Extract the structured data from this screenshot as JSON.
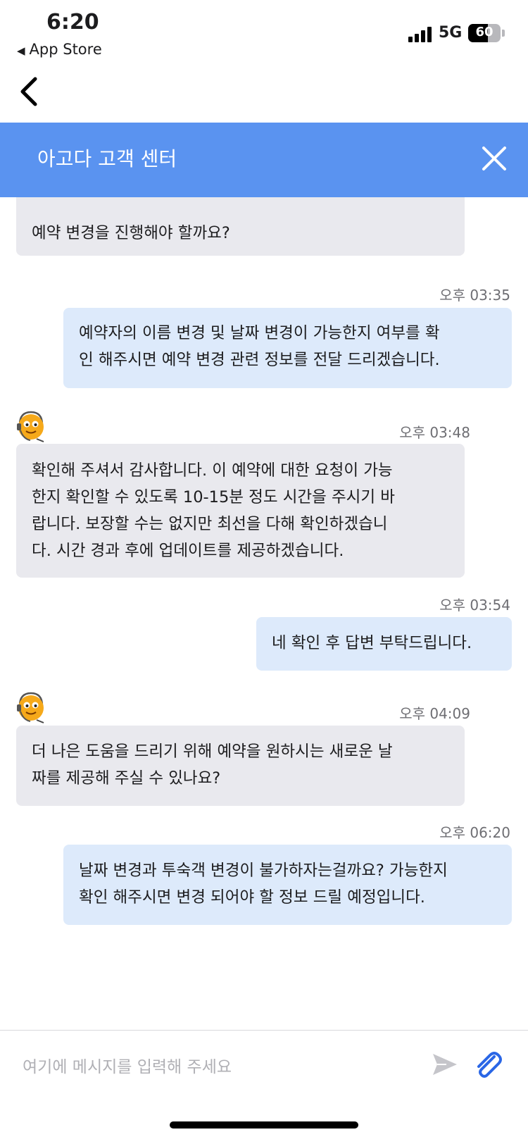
{
  "status_bar": {
    "time": "6:20",
    "back_app_label": "App Store",
    "network": "5G",
    "battery": "60",
    "battery_level": 0.6
  },
  "header": {
    "title": "아고다 고객 센터"
  },
  "messages": [
    {
      "sender": "agent",
      "text": "예약 변경을 진행해야 할까요?"
    },
    {
      "sender": "user",
      "time": "오후 03:35",
      "lines": [
        "예약자의 이름 변경 및 날짜 변경이 가능한지 여부를 확",
        "인 해주시면 예약 변경 관련 정보를 전달 드리겠습니다."
      ]
    },
    {
      "sender": "agent",
      "time": "오후 03:48",
      "lines": [
        "확인해 주셔서 감사합니다. 이 예약에 대한 요청이 가능",
        "한지 확인할 수 있도록 10-15분 정도 시간을 주시기 바",
        "랍니다. 보장할 수는 없지만 최선을 다해 확인하겠습니",
        "다. 시간 경과 후에 업데이트를 제공하겠습니다."
      ]
    },
    {
      "sender": "user",
      "time": "오후 03:54",
      "lines": [
        "네 확인 후 답변 부탁드립니다."
      ]
    },
    {
      "sender": "agent",
      "time": "오후 04:09",
      "lines": [
        "더 나은 도움을 드리기 위해 예약을 원하시는 새로운 날",
        "짜를 제공해 주실 수 있나요?"
      ]
    },
    {
      "sender": "user",
      "time": "오후 06:20",
      "lines": [
        "날짜 변경과 투숙객 변경이 불가하자는걸까요? 가능한지",
        "확인 해주시면 변경 되어야 할 정보 드릴 예정입니다."
      ]
    }
  ],
  "composer": {
    "placeholder": "여기에 메시지를 입력해 주세요"
  },
  "colors": {
    "header": "#5a93f0",
    "agent_bubble": "#e9e9ee",
    "user_bubble": "#ddeafb",
    "attach_icon": "#2a66e6"
  },
  "icons": [
    "chevron-left-icon",
    "close-icon",
    "agent-avatar-icon",
    "send-icon",
    "paperclip-icon"
  ]
}
